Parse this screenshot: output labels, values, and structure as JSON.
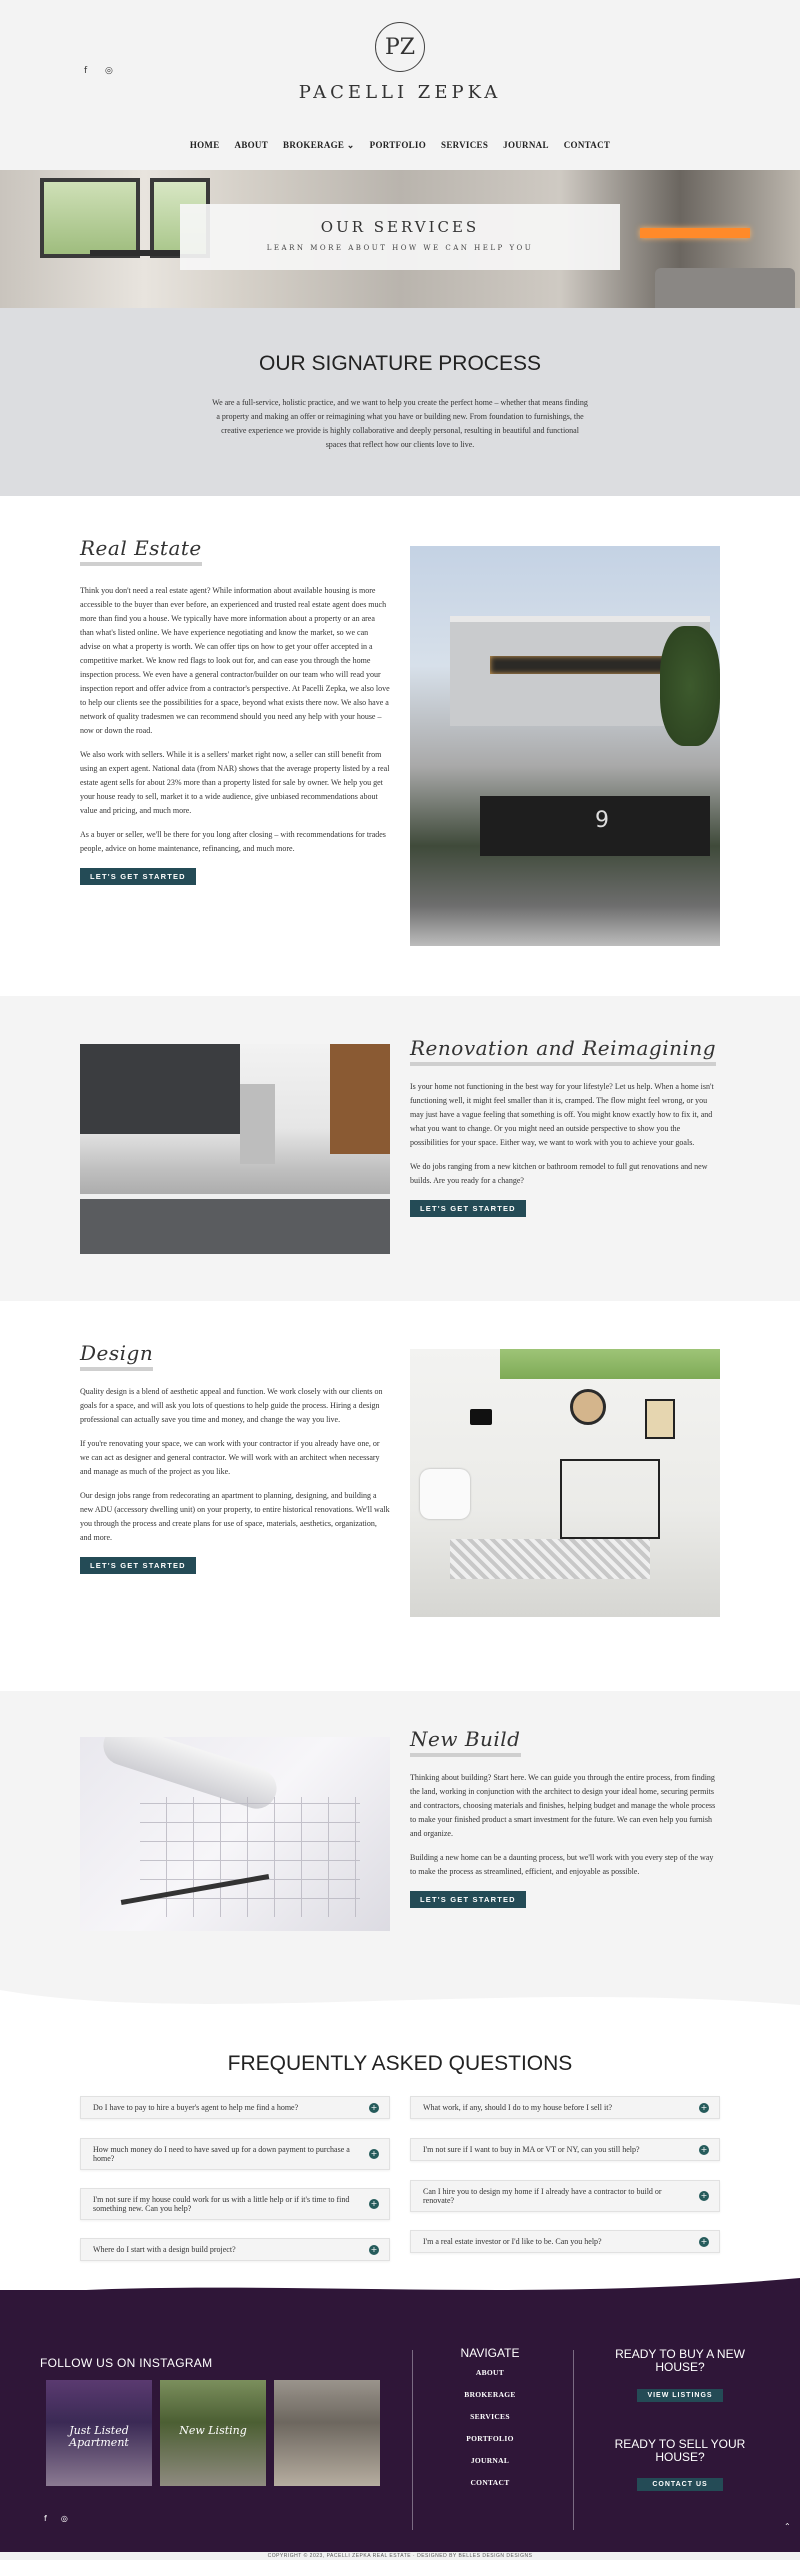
{
  "header": {
    "logo_monogram": "PZ",
    "logo_text": "PACELLI ZEPKA",
    "social": [
      "f",
      "◎"
    ]
  },
  "nav": {
    "home": "HOME",
    "about": "ABOUT",
    "brokerage": "BROKERAGE ⌄",
    "portfolio": "PORTFOLIO",
    "services": "SERVICES",
    "journal": "JOURNAL",
    "contact": "CONTACT"
  },
  "hero": {
    "title": "OUR SERVICES",
    "subtitle": "LEARN MORE ABOUT HOW WE CAN HELP YOU"
  },
  "signature": {
    "title": "OUR SIGNATURE PROCESS",
    "body": "We are a full-service, holistic practice, and we want to help you create the perfect home – whether that means finding a property and making an offer or reimagining what you have or building new. From foundation to furnishings, the creative experience we provide is highly collaborative and deeply personal, resulting in beautiful and functional spaces that reflect how our clients love to live."
  },
  "real_estate": {
    "title": "Real Estate",
    "p1": "Think you don't need a real estate agent? While information about available housing is more accessible to the buyer than ever before, an experienced and trusted real estate agent does much more than find you a house. We typically have more information about a property or an area than what's listed online. We have experience negotiating and know the market, so we can advise on what a property is worth. We can offer tips on how to get your offer accepted in a competitive market. We know red flags to look out for, and can ease you through the home inspection process. We even have a general contractor/builder on our team who will read your inspection report and offer advice from a contractor's perspective. At Pacelli Zepka, we also love to help our clients see the possibilities for a space, beyond what exists there now. We also have a network of quality tradesmen we can recommend should you need any help with your house – now or down the road.",
    "p2": "We also work with sellers. While it is a sellers' market right now, a seller can still benefit from using an expert agent. National data (from NAR) shows that the average property listed by a real estate agent sells for about 23% more than a property listed for sale by owner. We help you get your house ready to sell, market it to a wide audience, give unbiased recommendations about value and pricing, and much more.",
    "p3": "As a buyer or seller, we'll be there for you long after closing – with recommendations for trades people, advice on home maintenance, refinancing, and much more.",
    "cta": "LET'S GET STARTED"
  },
  "renovation": {
    "title": "Renovation and Reimagining",
    "p1": "Is your home not functioning in the best way for your lifestyle? Let us help. When a home isn't functioning well, it might feel smaller than it is, cramped. The flow might feel wrong, or you may just have a vague feeling that something is off. You might know exactly how to fix it, and what you want to change. Or you might need an outside perspective to show you the possibilities for your space. Either way, we want to work with you to achieve your goals.",
    "p2": "We do jobs ranging from a new kitchen or bathroom remodel to full gut renovations and new builds. Are you ready for a change?",
    "cta": "LET'S GET STARTED"
  },
  "design": {
    "title": "Design",
    "p1": "Quality design is a blend of aesthetic appeal and function. We work closely with our clients on goals for a space, and will ask you lots of questions to help guide the process. Hiring a design professional can actually save you time and money, and change the way you live.",
    "p2": "If you're renovating your space, we can work with your contractor if you already have one, or we can act as designer and general contractor. We will work with an architect when necessary and manage as much of the project as you like.",
    "p3": "Our design jobs range from redecorating an apartment to planning, designing, and building a new ADU (accessory dwelling unit) on your property, to entire historical renovations. We'll walk you through the process and create plans for use of space, materials, aesthetics, organization, and more.",
    "cta": "LET'S GET STARTED"
  },
  "new_build": {
    "title": "New Build",
    "p1": "Thinking about building? Start here. We can guide you through the entire process, from finding the land, working in conjunction with the architect to design your ideal home, securing permits and contractors, choosing materials and finishes, helping budget and manage the whole process to make your finished product a smart investment for the future. We can even help you furnish and organize.",
    "p2": "Building a new home can be a daunting process, but we'll work with you every step of the way to make the process as streamlined, efficient, and enjoyable as possible.",
    "cta": "LET'S GET STARTED"
  },
  "faq": {
    "title": "FREQUENTLY ASKED QUESTIONS",
    "left": [
      "Do I have to pay to hire a buyer's agent to help me find a home?",
      "How much money do I need to have saved up for a down payment to purchase a home?",
      "I'm not sure if my house could work for us with a little help or if it's time to find something new. Can you help?",
      "Where do I start with a design build project?"
    ],
    "right": [
      "What work, if any, should I do to my house before I sell it?",
      "I'm not sure if I want to buy in MA or VT or NY, can you still help?",
      "Can I hire you to design my home if I already have a contractor to build or renovate?",
      "I'm a real estate investor or I'd like to be. Can you help?"
    ]
  },
  "footer": {
    "instagram_title": "FOLLOW US ON INSTAGRAM",
    "insta_captions": [
      "Just Listed Apartment",
      "New Listing",
      ""
    ],
    "navigate_title": "NAVIGATE",
    "nav_links": [
      "ABOUT",
      "BROKERAGE",
      "SERVICES",
      "PORTFOLIO",
      "JOURNAL",
      "CONTACT"
    ],
    "buy_title": "READY TO BUY A NEW HOUSE?",
    "buy_cta": "VIEW LISTINGS",
    "sell_title": "READY TO SELL YOUR HOUSE?",
    "sell_cta": "CONTACT US",
    "social": [
      "f",
      "◎"
    ],
    "to_top": "⌃",
    "copyright": "COPYRIGHT © 2023, PACELLI ZEPKA REAL ESTATE · DESIGNED BY BELLES DESIGN DESIGNS"
  }
}
